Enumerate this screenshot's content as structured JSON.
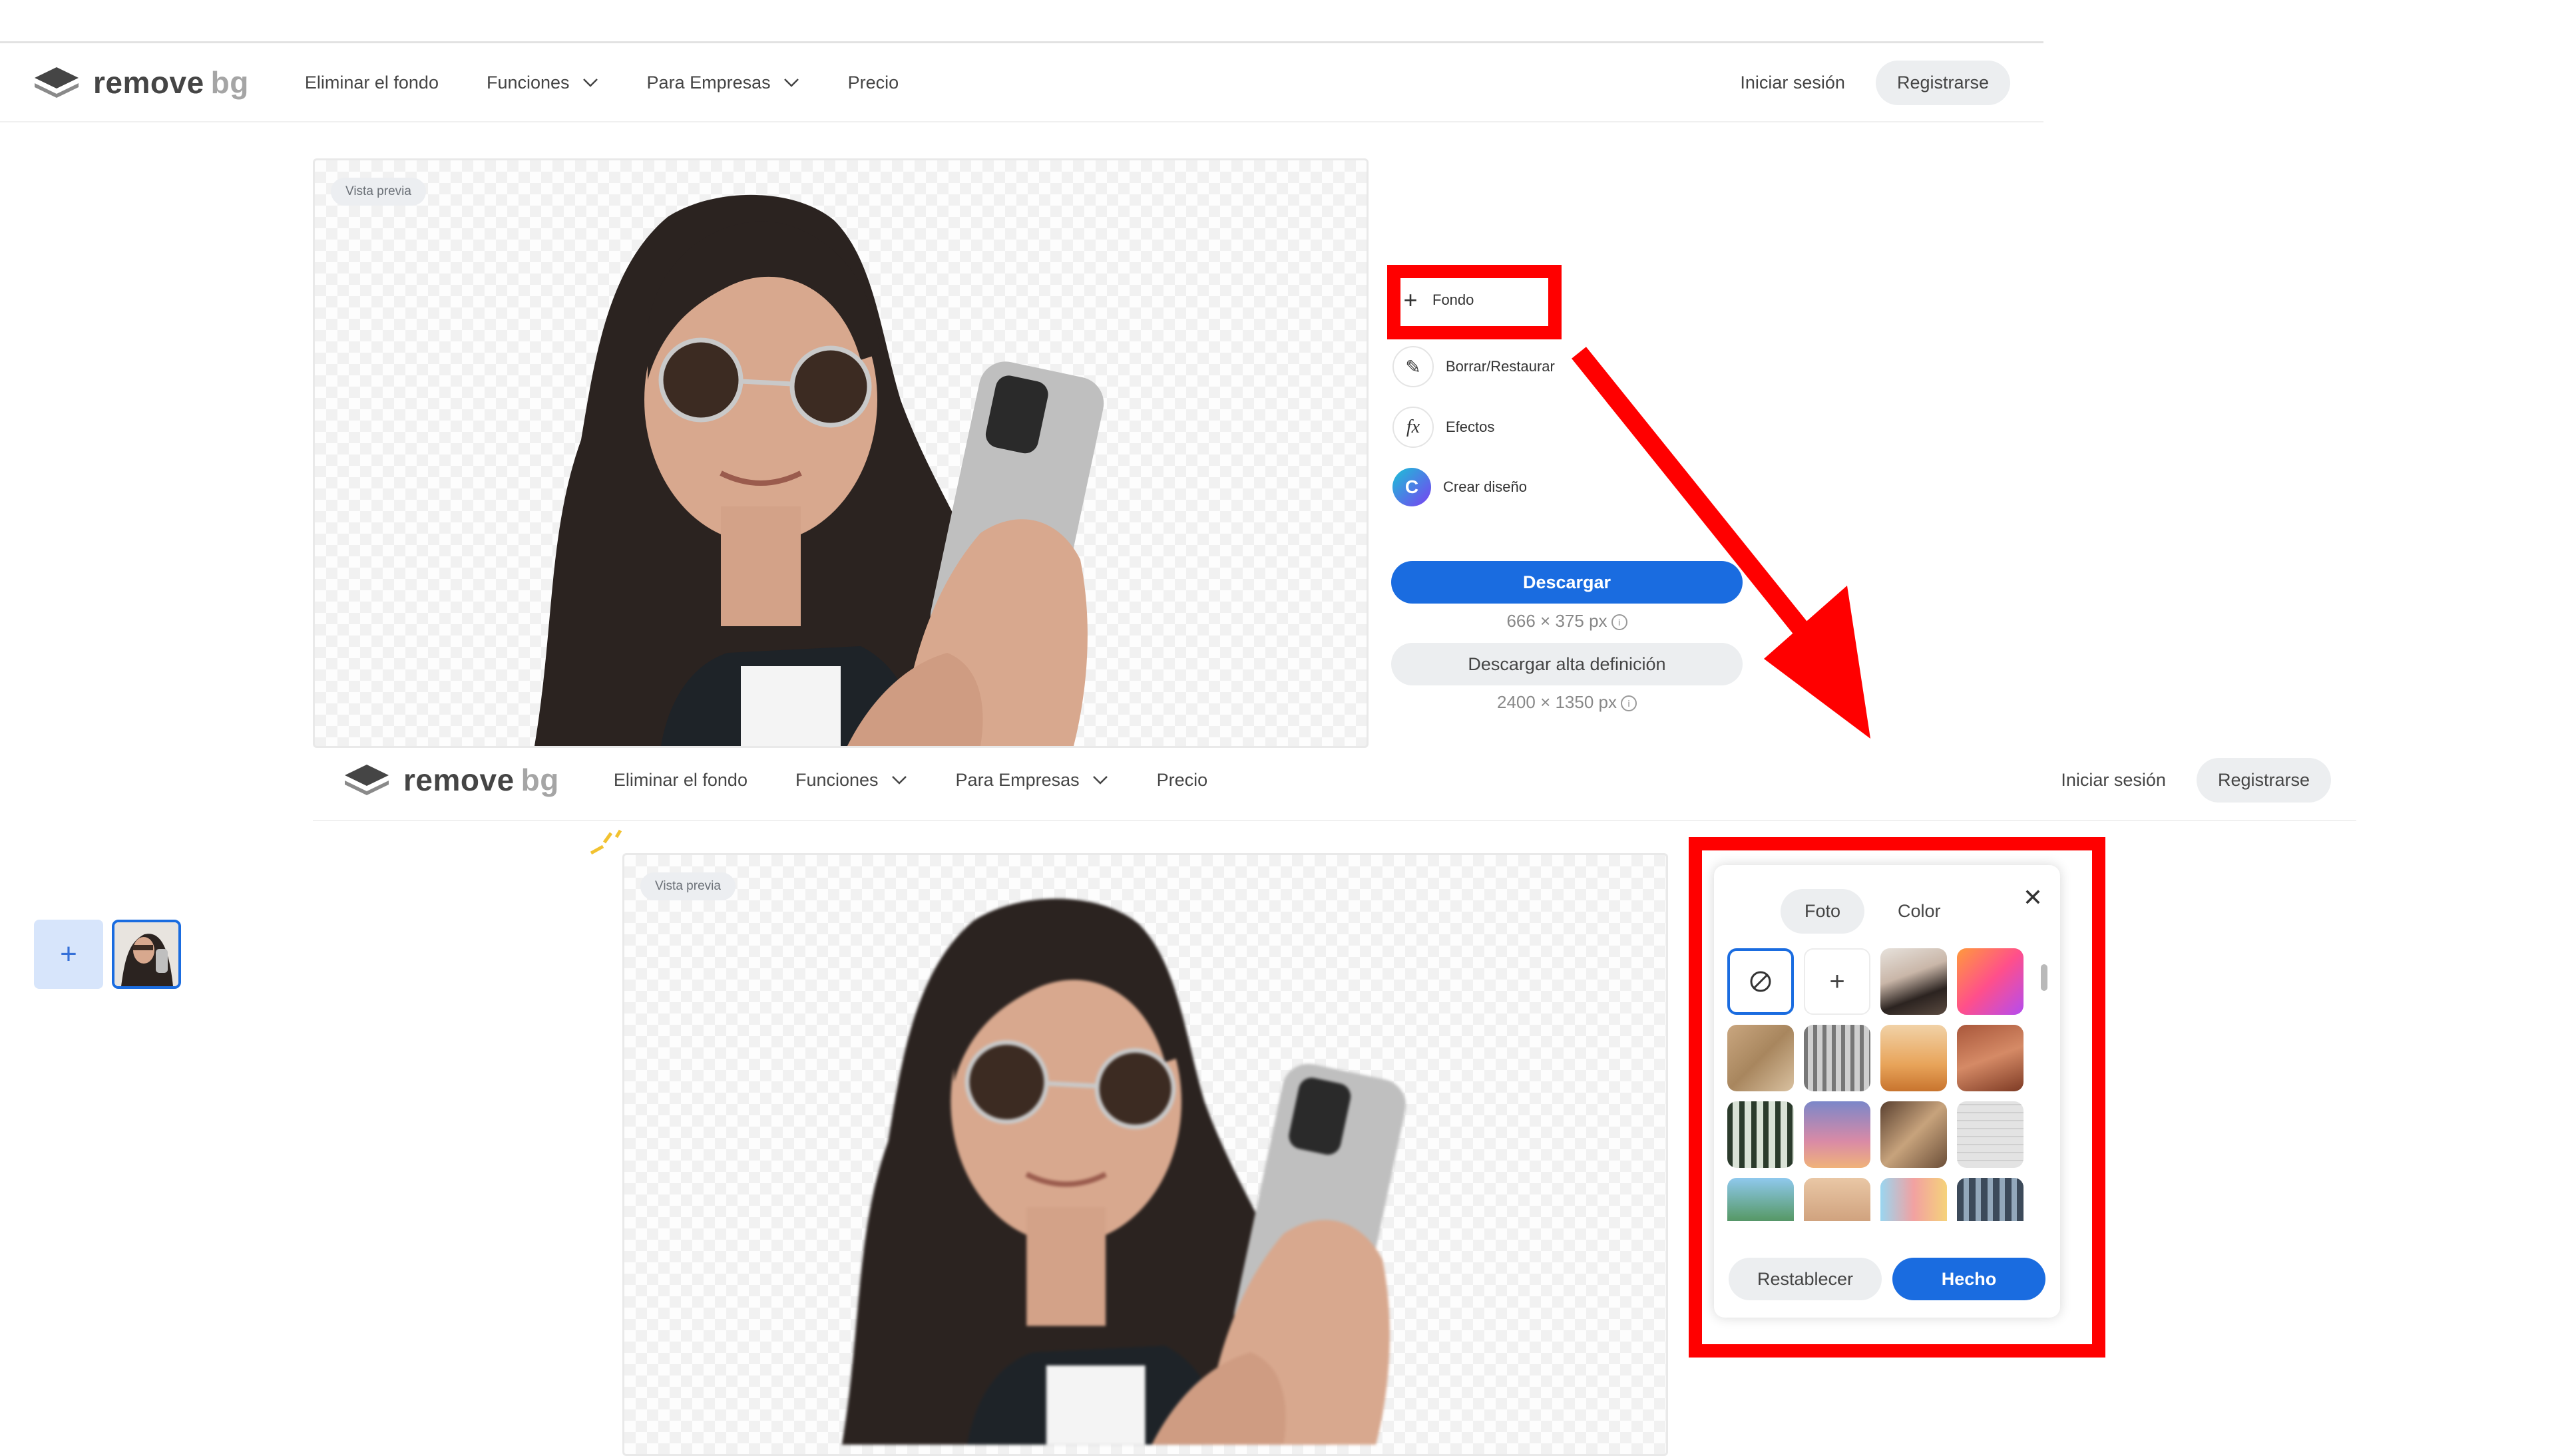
{
  "nav": {
    "logo_main": "remove",
    "logo_accent": "bg",
    "links": [
      "Eliminar el fondo",
      "Funciones",
      "Para Empresas",
      "Precio"
    ],
    "login": "Iniciar sesión",
    "register": "Registrarse"
  },
  "preview_badge": "Vista previa",
  "tools": {
    "fondo": "Fondo",
    "erase": "Borrar/Restaurar",
    "effects": "Efectos",
    "design": "Crear diseño"
  },
  "download": {
    "label": "Descargar",
    "size": "666 × 375 px",
    "hd_label": "Descargar alta definición",
    "hd_size": "2400 × 1350 px"
  },
  "panel": {
    "tab_photo": "Foto",
    "tab_color": "Color",
    "reset": "Restablecer",
    "done": "Hecho"
  },
  "colors": {
    "accent": "#1a6ce0",
    "highlight": "#ff0000"
  }
}
